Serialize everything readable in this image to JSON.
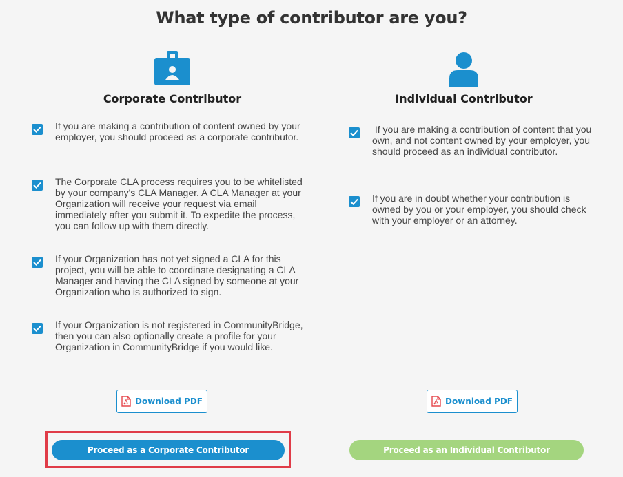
{
  "page": {
    "title": "What type of contributor are you?"
  },
  "corporate": {
    "icon": "id-badge-icon",
    "heading": "Corporate Contributor",
    "items": [
      "If you are making a contribution of content owned by your employer, you should proceed as a corporate contributor.",
      "The Corporate CLA process requires you to be whitelisted by your company's CLA Manager. A CLA Manager at your Organization will receive your request via email immediately after you submit it.  To expedite the process, you can follow up with them directly.",
      "If your Organization has not yet signed a CLA for this project, you will be able to coordinate designating a CLA Manager and having the CLA signed by someone at your Organization who is authorized to sign.",
      "If your Organization is not registered in CommunityBridge, then you can also optionally create a profile for your Organization in CommunityBridge if you would like."
    ],
    "download_label": "Download PDF",
    "proceed_label": "Proceed as a Corporate Contributor"
  },
  "individual": {
    "icon": "user-icon",
    "heading": "Individual Contributor",
    "items": [
      " If you are making a contribution of content that you own, and not content owned by your employer, you should proceed as an individual contributor.",
      "If you are in doubt whether your contribution is owned by you or your employer, you should check with your employer or an attorney."
    ],
    "download_label": "Download PDF",
    "proceed_label": "Proceed as an Individual Contributor"
  },
  "colors": {
    "primary": "#1b8fce",
    "individual_button": "#a4d57f",
    "highlight": "#e03c48",
    "pdf_icon": "#e5484d"
  }
}
